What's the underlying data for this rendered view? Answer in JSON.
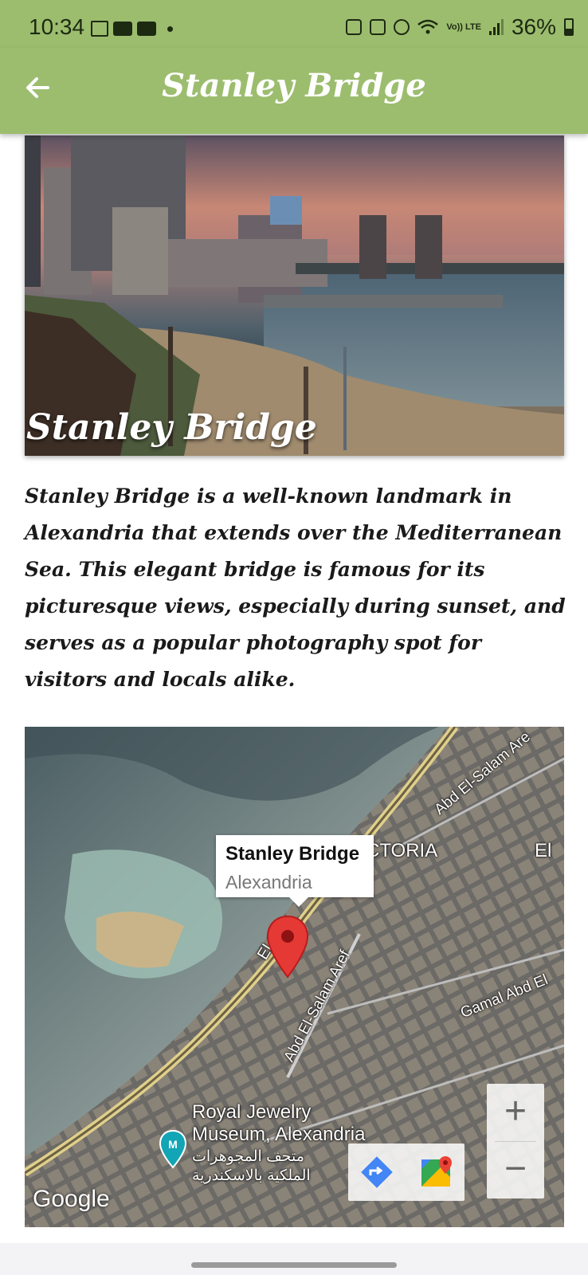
{
  "status_bar": {
    "time": "10:34",
    "network_label": "Vo)) LTE",
    "battery": "36%"
  },
  "app_bar": {
    "title": "Stanley Bridge",
    "back_icon": "arrow-left-icon"
  },
  "hero": {
    "caption": "Stanley Bridge"
  },
  "description": "Stanley Bridge is a well-known landmark in Alexandria that extends over the Mediterranean Sea. This elegant bridge is famous for its picturesque views, especially during sunset, and serves as a popular photography spot for visitors and locals alike.",
  "map": {
    "info_window": {
      "title": "Stanley Bridge",
      "subtitle": "Alexandria"
    },
    "labels": {
      "victoria": "CTORIA",
      "el": "El",
      "el_geish": "El Ga",
      "abd_el_salam_arefa": "Abd El-Salam Are",
      "abd_el_salam_aref_street": "Abd El-Salam Aref",
      "gamal_abd": "Gamal Abd El",
      "museum_en_1": "Royal Jewelry",
      "museum_en_2": "Museum, Alexandria",
      "museum_ar_1": "متحف المجوهرات",
      "museum_ar_2": "الملكية بالاسكندرية"
    },
    "zoom_in": "+",
    "zoom_out": "−",
    "attribution": "Google",
    "marker_color": "#e53935"
  },
  "colors": {
    "accent": "#9cbd6e"
  }
}
